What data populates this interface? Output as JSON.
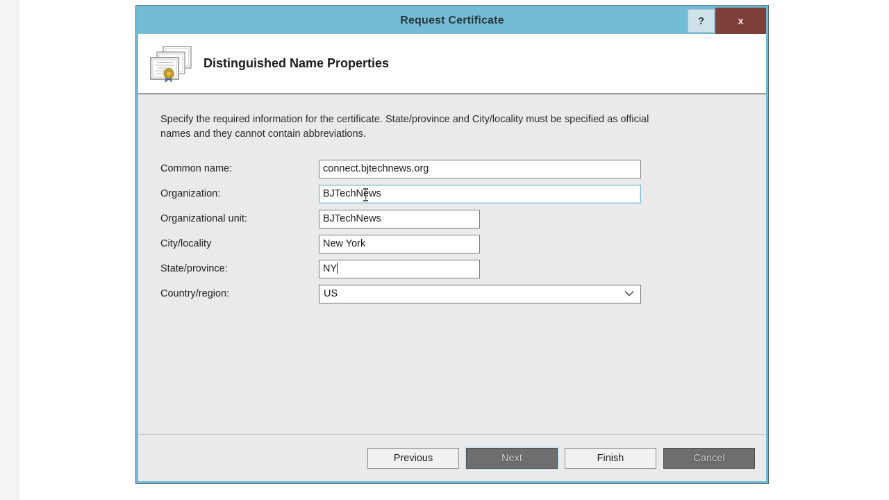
{
  "window": {
    "title": "Request Certificate",
    "help_label": "?",
    "close_label": "x"
  },
  "header": {
    "title": "Distinguished Name Properties",
    "icon": "certificate-stack-icon"
  },
  "main": {
    "instructions": "Specify the required information for the certificate. State/province and City/locality must be specified as official names and they cannot contain abbreviations.",
    "fields": [
      {
        "label": "Common name:",
        "value": "connect.bjtechnews.org",
        "name": "common-name",
        "width": "w-long",
        "focused": false
      },
      {
        "label": "Organization:",
        "value": "BJTechNews",
        "name": "organization",
        "width": "w-long",
        "focused": true
      },
      {
        "label": "Organizational unit:",
        "value": "BJTechNews",
        "name": "organizational-unit",
        "width": "w-mid",
        "focused": false
      },
      {
        "label": "City/locality",
        "value": "New York",
        "name": "city-locality",
        "width": "w-short",
        "focused": false
      },
      {
        "label": "State/province:",
        "value": "NY",
        "name": "state-province",
        "width": "w-short",
        "focused": false
      }
    ],
    "country": {
      "label": "Country/region:",
      "value": "US"
    }
  },
  "footer": {
    "buttons": [
      {
        "label": "Previous",
        "name": "previous-button",
        "style": "normal"
      },
      {
        "label": "Next",
        "name": "next-button",
        "style": "dark"
      },
      {
        "label": "Finish",
        "name": "finish-button",
        "style": "normal"
      },
      {
        "label": "Cancel",
        "name": "cancel-button",
        "style": "dark"
      }
    ]
  },
  "colors": {
    "titlebar": "#74bcd6",
    "dialog_border": "#6fb9d2",
    "close_button": "#7d3f3a",
    "body": "#eaeaea",
    "focus_border": "#7ab8d6"
  }
}
